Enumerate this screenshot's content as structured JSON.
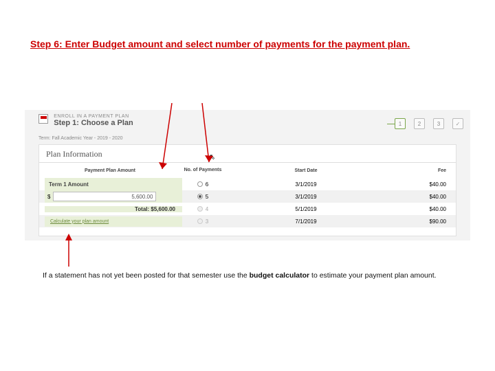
{
  "step_title": "Step 6: Enter Budget amount and select number of payments for the payment plan.",
  "enroll": {
    "eyebrow": "ENROLL IN A PAYMENT PLAN",
    "heading": "Step 1: Choose a Plan",
    "term_label": "Term: Fall Academic Year - 2019 - 2020"
  },
  "wizard": [
    "1",
    "2",
    "3",
    "✓"
  ],
  "panel_title": "Plan Information",
  "headers": {
    "amount": "Payment Plan Amount",
    "payments": "No. of Payments",
    "start": "Start Date",
    "fee": "Fee"
  },
  "term1_label": "Term 1 Amount",
  "amount_value": "5,600.00",
  "currency": "$",
  "total_label": "Total: $5,600.00",
  "calc_link": "Calculate your plan amount",
  "rows": [
    {
      "n": "6",
      "date": "3/1/2019",
      "fee": "$40.00",
      "selected": false,
      "disabled": false
    },
    {
      "n": "5",
      "date": "3/1/2019",
      "fee": "$40.00",
      "selected": true,
      "disabled": false
    },
    {
      "n": "4",
      "date": "5/1/2019",
      "fee": "$40.00",
      "selected": false,
      "disabled": true
    },
    {
      "n": "3",
      "date": "7/1/2019",
      "fee": "$90.00",
      "selected": false,
      "disabled": true
    }
  ],
  "note_prefix": "If a statement has not yet been posted for that semester use the ",
  "note_bold": "budget calculator",
  "note_suffix": " to estimate your payment plan amount."
}
